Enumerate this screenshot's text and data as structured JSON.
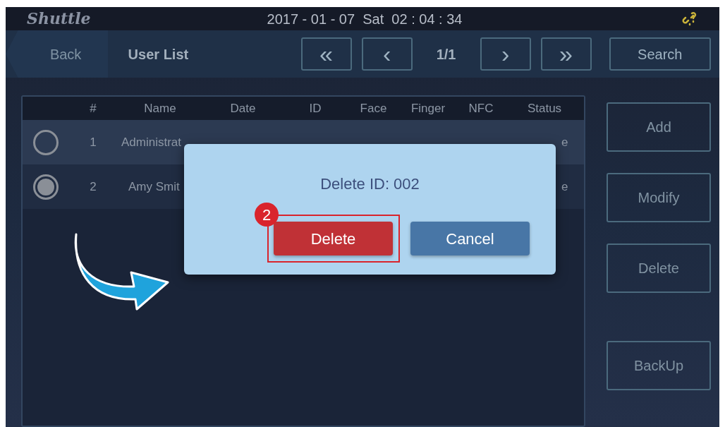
{
  "header": {
    "logo": "Shuttle",
    "datetime": "2017 - 01 - 07  Sat  02 : 04 : 34"
  },
  "nav": {
    "back": "Back",
    "title": "User List",
    "first": "«",
    "prev": "‹",
    "page": "1/1",
    "next": "›",
    "last": "»",
    "search": "Search"
  },
  "table": {
    "columns": [
      "#",
      "Name",
      "Date",
      "ID",
      "Face",
      "Finger",
      "NFC",
      "Status"
    ],
    "rows": [
      {
        "selected": false,
        "number": "1",
        "name": "Administrat",
        "status": "e"
      },
      {
        "selected": true,
        "number": "2",
        "name": "Amy Smit",
        "status": "e"
      }
    ]
  },
  "side_buttons": [
    "Add",
    "Modify",
    "Delete",
    "BackUp"
  ],
  "dialog": {
    "message": "Delete ID: 002",
    "confirm": "Delete",
    "cancel": "Cancel"
  },
  "callout": {
    "step": "2"
  }
}
